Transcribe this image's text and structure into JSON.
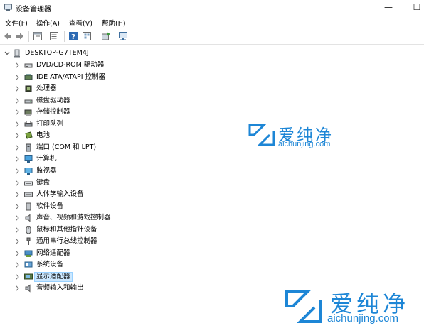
{
  "window": {
    "title": "设备管理器",
    "controls": {
      "minimize": "—",
      "maximize": "☐"
    }
  },
  "menu": {
    "items": [
      "文件(F)",
      "操作(A)",
      "查看(V)",
      "帮助(H)"
    ]
  },
  "toolbar": {
    "icons": [
      "back-arrow-icon",
      "forward-arrow-icon",
      "properties-icon",
      "details-view-icon",
      "help-icon",
      "device-view-icon",
      "update-driver-icon",
      "scan-hardware-icon"
    ]
  },
  "tree": {
    "root": "DESKTOP-G7TEM4J",
    "items": [
      {
        "label": "DVD/CD-ROM 驱动器",
        "icon": "dvd-drive-icon"
      },
      {
        "label": "IDE ATA/ATAPI 控制器",
        "icon": "ide-controller-icon"
      },
      {
        "label": "处理器",
        "icon": "processor-icon"
      },
      {
        "label": "磁盘驱动器",
        "icon": "disk-drive-icon"
      },
      {
        "label": "存储控制器",
        "icon": "storage-controller-icon"
      },
      {
        "label": "打印队列",
        "icon": "printer-icon"
      },
      {
        "label": "电池",
        "icon": "battery-icon"
      },
      {
        "label": "端口 (COM 和 LPT)",
        "icon": "port-icon"
      },
      {
        "label": "计算机",
        "icon": "computer-icon"
      },
      {
        "label": "监视器",
        "icon": "monitor-icon"
      },
      {
        "label": "键盘",
        "icon": "keyboard-icon"
      },
      {
        "label": "人体学输入设备",
        "icon": "hid-icon"
      },
      {
        "label": "软件设备",
        "icon": "software-device-icon"
      },
      {
        "label": "声音、视频和游戏控制器",
        "icon": "sound-icon"
      },
      {
        "label": "鼠标和其他指针设备",
        "icon": "mouse-icon"
      },
      {
        "label": "通用串行总线控制器",
        "icon": "usb-icon"
      },
      {
        "label": "网络适配器",
        "icon": "network-adapter-icon"
      },
      {
        "label": "系统设备",
        "icon": "system-device-icon"
      },
      {
        "label": "显示适配器",
        "icon": "display-adapter-icon",
        "selected": true
      },
      {
        "label": "音频输入和输出",
        "icon": "audio-io-icon"
      }
    ]
  },
  "watermark": {
    "name": "爱纯净",
    "url": "aichunjing.com",
    "color": "#1d86d6"
  }
}
